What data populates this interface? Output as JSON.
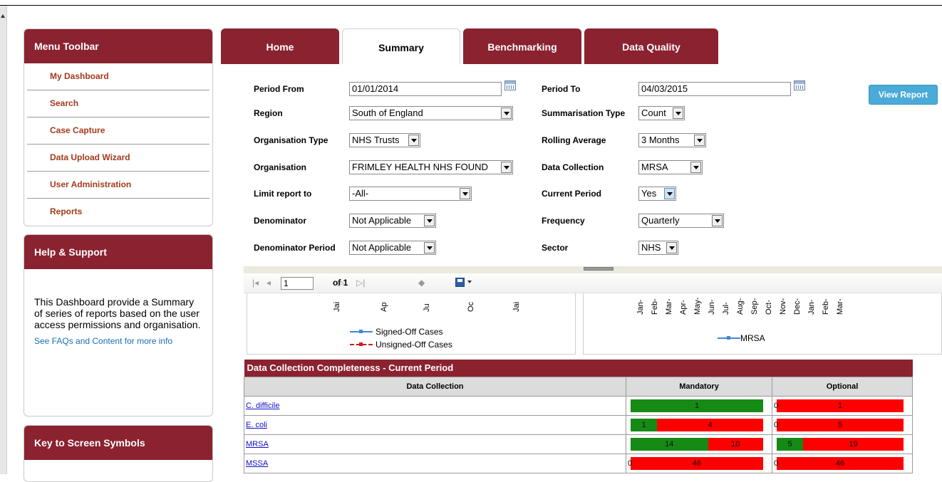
{
  "sidebar": {
    "menu_title": "Menu Toolbar",
    "menu_items": [
      "My Dashboard",
      "Search",
      "Case Capture",
      "Data Upload Wizard",
      "User Administration",
      "Reports"
    ],
    "help_title": "Help & Support",
    "help_text": "This Dashboard provide a Summary of series of reports based on the user access permissions and organisation.",
    "help_link": "See FAQs and Content for more info",
    "key_title": "Key to Screen Symbols"
  },
  "tabs": [
    {
      "label": "Home",
      "active": false
    },
    {
      "label": "Summary",
      "active": true
    },
    {
      "label": "Benchmarking",
      "active": false
    },
    {
      "label": "Data Quality",
      "active": false
    }
  ],
  "form": {
    "period_from": {
      "label": "Period From",
      "value": "01/01/2014"
    },
    "period_to": {
      "label": "Period To",
      "value": "04/03/2015"
    },
    "region": {
      "label": "Region",
      "value": "South of England"
    },
    "summarisation_type": {
      "label": "Summarisation Type",
      "value": "Count"
    },
    "organisation_type": {
      "label": "Organisation Type",
      "value": "NHS Trusts"
    },
    "rolling_average": {
      "label": "Rolling Average",
      "value": "3 Months"
    },
    "organisation": {
      "label": "Organisation",
      "value": "FRIMLEY HEALTH NHS FOUND"
    },
    "data_collection": {
      "label": "Data Collection",
      "value": "MRSA"
    },
    "limit_report": {
      "label": "Limit report to",
      "value": "-All-"
    },
    "current_period": {
      "label": "Current Period",
      "value": "Yes"
    },
    "denominator": {
      "label": "Denominator",
      "value": "Not Applicable"
    },
    "frequency": {
      "label": "Frequency",
      "value": "Quarterly"
    },
    "denominator_period": {
      "label": "Denominator Period",
      "value": "Not Applicable"
    },
    "sector": {
      "label": "Sector",
      "value": "NHS"
    },
    "view_report": "View Report"
  },
  "report_toolbar": {
    "page": "1",
    "of_label": "of 1",
    "icons": [
      "first-page-icon",
      "prev-page-icon",
      "next-page-icon",
      "last-page-icon",
      "back-icon",
      "save-export-icon"
    ]
  },
  "chart_data": [
    {
      "type": "line",
      "x": [
        "Jan",
        "Apr",
        "Jul",
        "Oct",
        "Jan"
      ],
      "tick_labels": [
        "Jai",
        "Ap",
        "Ju",
        "Oc",
        "Jai"
      ],
      "series": [
        {
          "name": "Signed-Off Cases",
          "color": "#3e88d4"
        },
        {
          "name": "Unsigned-Off Cases",
          "color": "#d11c1c"
        }
      ]
    },
    {
      "type": "line",
      "tick_labels": [
        "Jan-",
        "Feb-",
        "Mar-",
        "Apr-",
        "May-",
        "Jun-",
        "Jul-",
        "Aug-",
        "Sep-",
        "Oct-",
        "Nov-",
        "Dec-",
        "Jan-",
        "Feb-",
        "Mar-"
      ],
      "series": [
        {
          "name": "MRSA",
          "color": "#3e88d4"
        }
      ]
    }
  ],
  "completeness": {
    "title": "Data Collection Completeness - Current Period",
    "headers": [
      "Data Collection",
      "Mandatory",
      "Optional"
    ],
    "rows": [
      {
        "name": "C. difficile",
        "mandatory": {
          "green": 1,
          "red": 0
        },
        "optional": {
          "green": 0,
          "red": 1
        }
      },
      {
        "name": "E. coli",
        "mandatory": {
          "green": 1,
          "red": 4
        },
        "optional": {
          "green": 0,
          "red": 5
        }
      },
      {
        "name": "MRSA",
        "mandatory": {
          "green": 14,
          "red": 10
        },
        "optional": {
          "green": 5,
          "red": 19
        }
      },
      {
        "name": "MSSA",
        "mandatory": {
          "green": 0,
          "red": 46
        },
        "optional": {
          "green": 0,
          "red": 46
        }
      }
    ],
    "colors": {
      "green": "#158a15",
      "red": "#ff0000"
    }
  },
  "colors": {
    "brand": "#8b2230",
    "link": "#1a6fb8",
    "button": "#4aaad8"
  }
}
